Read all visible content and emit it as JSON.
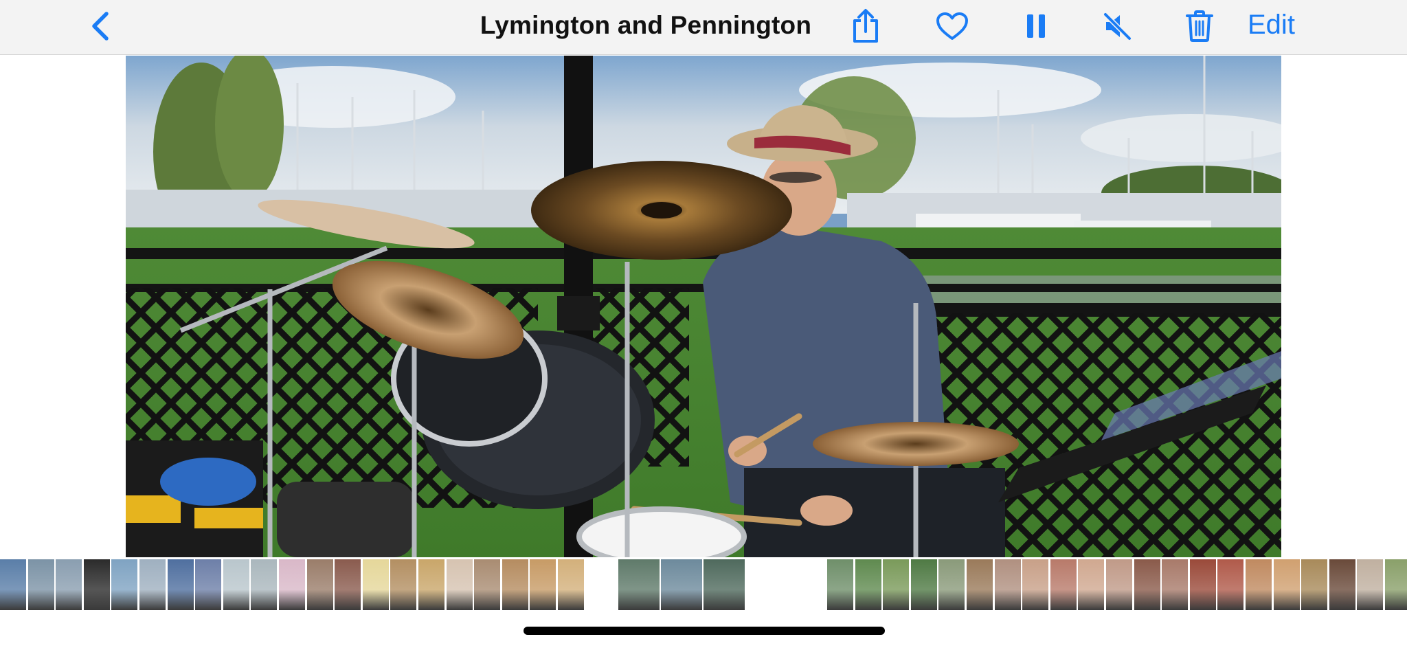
{
  "header": {
    "title": "Lymington and Pennington",
    "edit_label": "Edit",
    "icons": [
      "back-chevron-icon",
      "share-icon",
      "heart-icon",
      "pause-icon",
      "mute-icon",
      "trash-icon"
    ],
    "accent_color": "#1a7cf5"
  },
  "viewer": {
    "content": "video-frame-drummer"
  },
  "filmstrip": {
    "thumbnails": [
      {
        "color": "#5a7ea8"
      },
      {
        "color": "#7c93a6"
      },
      {
        "color": "#8a9eb0"
      },
      {
        "color": "#2b2b2b"
      },
      {
        "color": "#7fa3c2"
      },
      {
        "color": "#9fb0c0"
      },
      {
        "color": "#4f6f9f"
      },
      {
        "color": "#6d7fa8"
      },
      {
        "color": "#b9c6cc"
      },
      {
        "color": "#aab7bd"
      },
      {
        "color": "#d9b8c8"
      },
      {
        "color": "#9a7d6a"
      },
      {
        "color": "#8a5b4e"
      },
      {
        "color": "#e5d79a"
      },
      {
        "color": "#b38f62"
      },
      {
        "color": "#c9a66a"
      },
      {
        "color": "#d6c3b1"
      },
      {
        "color": "#a98c72"
      },
      {
        "color": "#b58c60"
      },
      {
        "color": "#c79b66"
      },
      {
        "color": "#d3b07b"
      }
    ],
    "current": [
      {
        "color": "#5f7a6a"
      },
      {
        "color": "#6d8a9c"
      },
      {
        "color": "#4f6a5d"
      }
    ],
    "thumbnails_right": [
      {
        "color": "#6f8f6a"
      },
      {
        "color": "#5f8a4f"
      },
      {
        "color": "#7a9a5a"
      },
      {
        "color": "#4f7a44"
      },
      {
        "color": "#8a9a7a"
      },
      {
        "color": "#9a7a5a"
      },
      {
        "color": "#b09080"
      },
      {
        "color": "#c8a088"
      },
      {
        "color": "#b87a6a"
      },
      {
        "color": "#d0a890"
      },
      {
        "color": "#c09a88"
      },
      {
        "color": "#8a5a4a"
      },
      {
        "color": "#a87a6a"
      },
      {
        "color": "#9a4a3a"
      },
      {
        "color": "#b05a4a"
      },
      {
        "color": "#c08a60"
      },
      {
        "color": "#d0a070"
      },
      {
        "color": "#a88a5a"
      },
      {
        "color": "#6a4a3a"
      },
      {
        "color": "#c0b0a0"
      },
      {
        "color": "#8aa06a"
      }
    ]
  }
}
